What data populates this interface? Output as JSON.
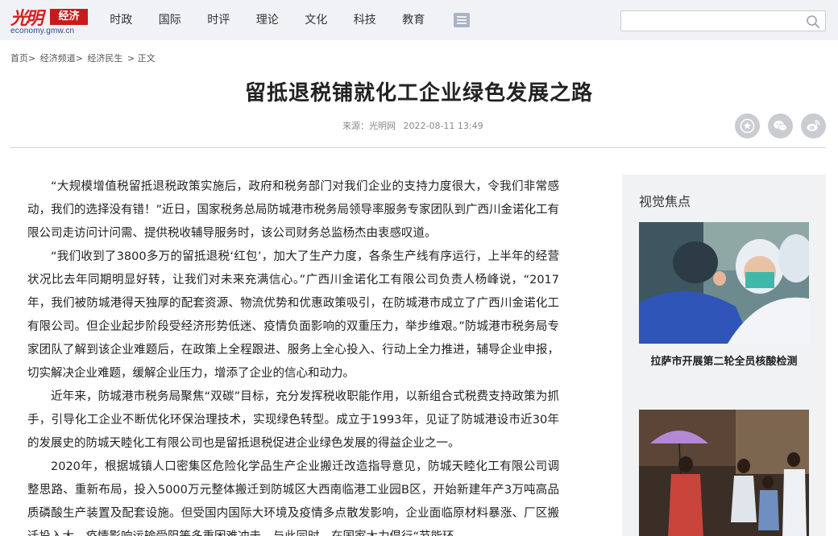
{
  "logo": {
    "brand_chars": "光明",
    "badge": "经济",
    "domain": "economy.gmw.cn"
  },
  "nav": {
    "items": [
      "时政",
      "国际",
      "时评",
      "理论",
      "文化",
      "科技",
      "教育"
    ]
  },
  "search": {
    "placeholder": "",
    "value": ""
  },
  "breadcrumb": [
    "首页>",
    "经济频道>",
    "经济民生",
    "> 正文"
  ],
  "article": {
    "title": "留抵退税铺就化工企业绿色发展之路",
    "source": "来源：光明网",
    "date": "2022-08-11 13:49",
    "paragraphs": [
      "“大规模增值税留抵退税政策实施后，政府和税务部门对我们企业的支持力度很大，令我们非常感动，我们的选择没有错！”近日，国家税务总局防城港市税务局领导率服务专家团队到广西川金诺化工有限公司走访问计问需、提供税收辅导服务时，该公司财务总监杨杰由衷感叹道。",
      "“我们收到了3800多万的留抵退税‘红包’，加大了生产力度，各条生产线有序运行，上半年的经营状况比去年同期明显好转，让我们对未来充满信心。”广西川金诺化工有限公司负责人杨峰说，“2017年，我们被防城港得天独厚的配套资源、物流优势和优惠政策吸引，在防城港市成立了广西川金诺化工有限公司。但企业起步阶段受经济形势低迷、疫情负面影响的双重压力，举步维艰。”防城港市税务局专家团队了解到该企业难题后，在政策上全程跟进、服务上全心投入、行动上全力推进，辅导企业申报，切实解决企业难题，缓解企业压力，增添了企业的信心和动力。",
      "近年来，防城港市税务局聚焦“双碳”目标，充分发挥税收职能作用，以新组合式税费支持政策为抓手，引导化工企业不断优化环保治理技术，实现绿色转型。成立于1993年，见证了防城港设市近30年的发展史的防城天睦化工有限公司也是留抵退税促进企业绿色发展的得益企业之一。",
      "2020年，根据城镇人口密集区危险化学品生产企业搬迁改造指导意见，防城天睦化工有限公司调整思路、重新布局，投入5000万元整体搬迁到防城区大西南临港工业园B区，开始新建年产3万吨高品质磷酸生产装置及配套设施。但受国内国际大环境及疫情多点散发影响，企业面临原材料暴涨、厂区搬迁投入大、疫情影响运输受阻等多重困难冲击。与此同时，在国家大力倡行“节能环"
    ]
  },
  "sidebar": {
    "title": "视觉焦点",
    "items": [
      {
        "caption": "拉萨市开展第二轮全员核酸检测"
      },
      {
        "caption": ""
      }
    ]
  },
  "colors": {
    "header_bg": "#f0f2f5",
    "brand_red": "#c81a1a",
    "share_icon_bg": "#c9cdd2",
    "sidebar_bg": "#f1f2f4"
  },
  "icons": [
    "menu-icon",
    "search-icon",
    "favorite-star-icon",
    "wechat-icon",
    "weibo-icon"
  ]
}
